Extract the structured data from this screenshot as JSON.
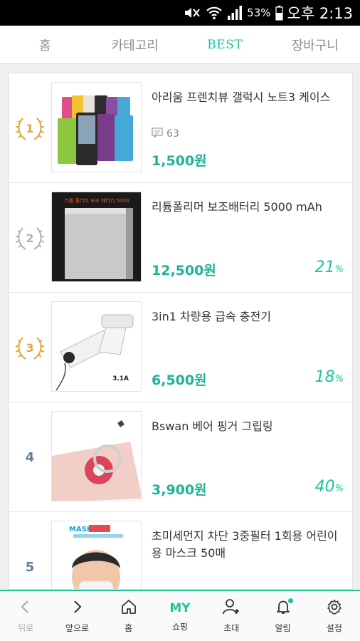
{
  "status": {
    "battery": "53%",
    "time": "오후 2:13"
  },
  "tabs": [
    {
      "label": "홈"
    },
    {
      "label": "카테고리"
    },
    {
      "label": "BEST"
    },
    {
      "label": "장바구니"
    }
  ],
  "products": [
    {
      "rank": "1",
      "title": "아리움 프렌치뷰 갤럭시 노트3 케이스",
      "comments": "63",
      "price": "1,500원",
      "discount": ""
    },
    {
      "rank": "2",
      "title": "리튬폴리머 보조배터리 5000 mAh",
      "price": "12,500원",
      "discount": "21",
      "image_text": "리튬 폴리머 보조 배터리 5000"
    },
    {
      "rank": "3",
      "title": "3in1 차량용 급속 충전기",
      "price": "6,500원",
      "discount": "18",
      "image_text": "3.1A"
    },
    {
      "rank": "4",
      "title": "Bswan 베어 핑거 그립링",
      "price": "3,900원",
      "discount": "40"
    },
    {
      "rank": "5",
      "title": "초미세먼지 차단 3중필터 1회용 어린이용 마스크 50매",
      "price": "",
      "discount": "",
      "image_text": "MASK"
    }
  ],
  "discount_suffix": "%",
  "bottom_nav": [
    {
      "label": "뒤로",
      "icon": "back-icon"
    },
    {
      "label": "앞으로",
      "icon": "forward-icon"
    },
    {
      "label": "홈",
      "icon": "home-icon"
    },
    {
      "label": "쇼핑",
      "icon": "my-text",
      "icon_text": "MY"
    },
    {
      "label": "초대",
      "icon": "invite-icon"
    },
    {
      "label": "알림",
      "icon": "bell-icon"
    },
    {
      "label": "설정",
      "icon": "gear-icon"
    }
  ],
  "colors": {
    "accent": "#1fc49a",
    "gold": "#e7a53b",
    "silver": "#aab3bf",
    "rank_blue": "#5f7d9a"
  }
}
